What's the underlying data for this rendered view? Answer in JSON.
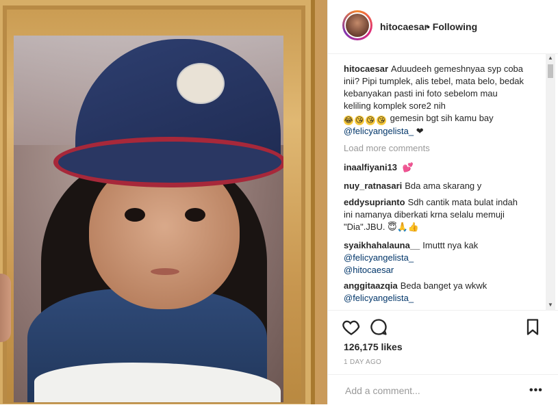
{
  "header": {
    "username": "hitocaesar",
    "separator": "•",
    "follow_status": "Following"
  },
  "caption": {
    "username": "hitocaesar",
    "text": "Aduudeeh gemeshnyaa syp coba inii? Pipi tumplek, alis tebel, mata belo, bedak kebanyakan pasti ini foto sebelom mau keliling komplek sore2 nih",
    "emojis": [
      "joy-emoji",
      "kiss-emoji",
      "kiss-emoji",
      "kiss-emoji"
    ],
    "text2": "gemesin bgt sih kamu bay",
    "mention": "@felicyangelista_",
    "heart": "❤"
  },
  "load_more": "Load more comments",
  "comments": [
    {
      "user": "inaalfiyani13",
      "text": "",
      "emoji": "💕"
    },
    {
      "user": "nuy_ratnasari",
      "text": "Bda ama skarang y"
    },
    {
      "user": "eddysuprianto",
      "text": "Sdh cantik mata bulat indah ini namanya diberkati krna selalu memuji \"Dia\".JBU.",
      "emoji": "😇🙏👍"
    },
    {
      "user": "syaikhahalauna__",
      "text": "Imuttt nya kak",
      "mentions": [
        "@felicyangelista_",
        "@hitocaesar"
      ]
    },
    {
      "user": "anggitaazqia",
      "text": "Beda banget ya wkwk",
      "mentions": [
        "@felicyangelista_"
      ]
    }
  ],
  "likes": "126,175 likes",
  "time": "1 DAY AGO",
  "add_comment": {
    "placeholder": "Add a comment..."
  },
  "more_label": "•••",
  "colors": {
    "mention": "#003569",
    "muted": "#999999",
    "border": "#efefef"
  }
}
